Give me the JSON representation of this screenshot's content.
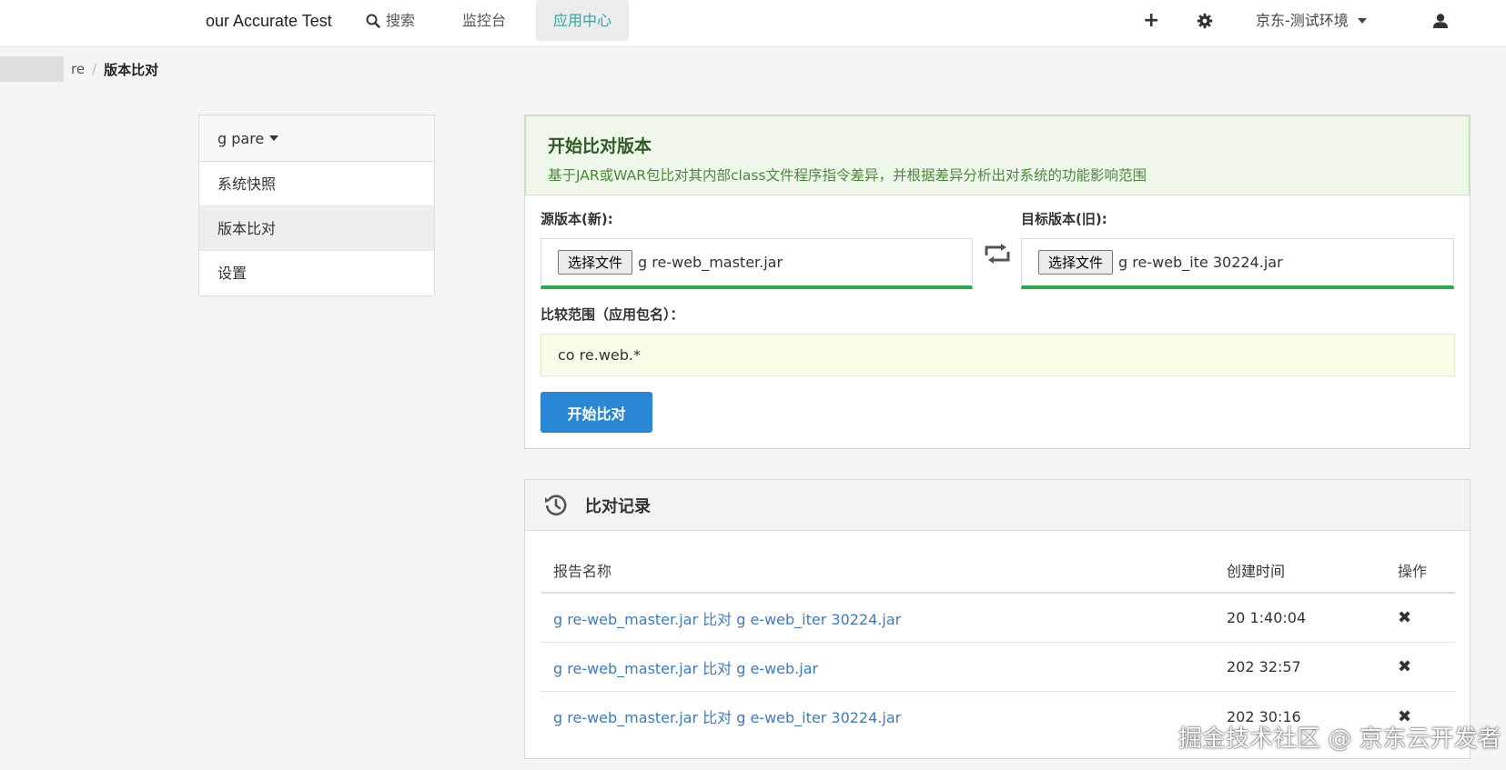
{
  "navbar": {
    "brand": "our Accurate Test",
    "search_label": "搜索",
    "monitor_label": "监控台",
    "apps_label": "应用中心",
    "env_label": "京东-测试环境"
  },
  "breadcrumb": {
    "parent": "re",
    "current": "版本比对"
  },
  "sidebar": {
    "project": "g pare",
    "items": [
      {
        "label": "系统快照"
      },
      {
        "label": "版本比对"
      },
      {
        "label": "设置"
      }
    ]
  },
  "compare": {
    "title": "开始比对版本",
    "subtitle": "基于JAR或WAR包比对其内部class文件程序指令差异，并根据差异分析出对系统的功能影响范围",
    "source_label": "源版本(新):",
    "target_label": "目标版本(旧):",
    "choose_file": "选择文件",
    "source_file": "g re-web_master.jar",
    "target_file": "g re-web_ite 30224.jar",
    "scope_label": "比较范围（应用包名）：",
    "scope_value": "co re.web.*",
    "start_button": "开始比对"
  },
  "records": {
    "title": "比对记录",
    "columns": [
      "报告名称",
      "创建时间",
      "操作"
    ],
    "rows": [
      {
        "name": "g re-web_master.jar 比对 g e-web_iter 30224.jar",
        "time": "20 1:40:04"
      },
      {
        "name": "g re-web_master.jar 比对 g e-web.jar",
        "time": "202 32:57"
      },
      {
        "name": "g re-web_master.jar 比对 g e-web_iter 30224.jar",
        "time": "202 30:16"
      }
    ]
  },
  "watermark": "掘金技术社区 @ 京东云开发者"
}
